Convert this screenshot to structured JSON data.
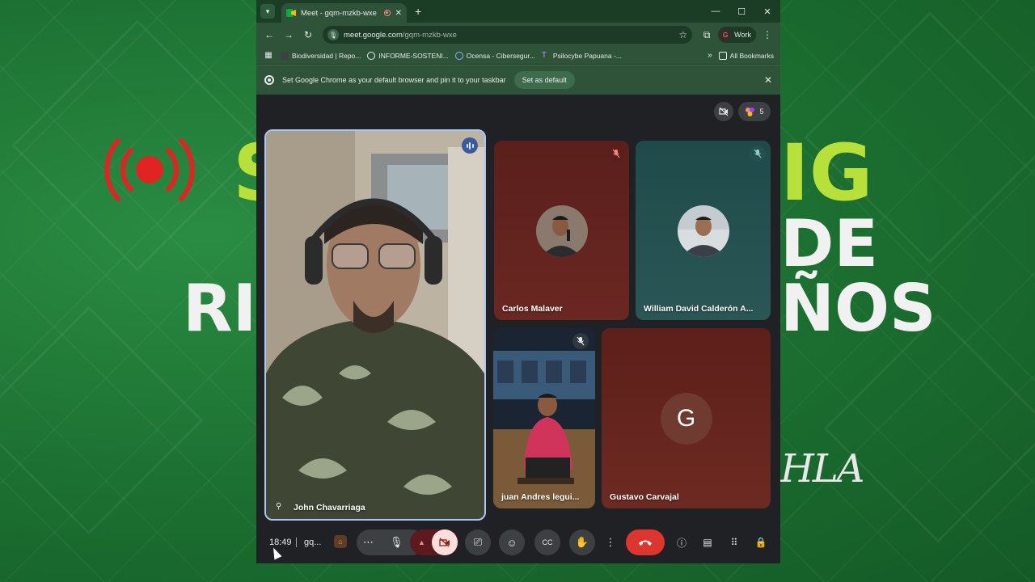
{
  "browser": {
    "tab_title": "Meet - gqm-mzkb-wxe",
    "url_host": "meet.google.com",
    "url_path": "/gqm-mzkb-wxe",
    "profile_initial": "G",
    "profile_label": "Work",
    "bookmarks": [
      {
        "label": "Biodiversidad | Repo...",
        "icon": "bookmark-favicon",
        "color": "#3c4043"
      },
      {
        "label": "INFORME-SOSTENI...",
        "icon": "globe-icon",
        "color": "#e8eaed"
      },
      {
        "label": "Ocensa - Cibersegur...",
        "icon": "globe-icon",
        "color": "#8ab4f8"
      },
      {
        "label": "Psilocybe Papuana -...",
        "icon": "t-favicon",
        "color": "#c58af9"
      }
    ],
    "all_bookmarks": "All Bookmarks",
    "infobar_text": "Set Google Chrome as your default browser and pin it to your taskbar",
    "infobar_button": "Set as default"
  },
  "meet": {
    "participant_count": "5",
    "participants": [
      {
        "name": "John Chavarriaga",
        "state": "speaking"
      },
      {
        "name": "Carlos Malaver",
        "state": "muted"
      },
      {
        "name": "William David Calderón A...",
        "state": "muted"
      },
      {
        "name": "juan Andres legui...",
        "state": "muted"
      },
      {
        "name": "Gustavo Carvajal",
        "initial": "G"
      }
    ],
    "clock": "18:49",
    "meeting_code_short": "gq..."
  },
  "background": {
    "words": [
      "S",
      "IG",
      "DE",
      "RI",
      "ÑOS"
    ],
    "signature": "HLA",
    "accent_red": "#e02424",
    "accent_lime": "#b8e03a"
  }
}
